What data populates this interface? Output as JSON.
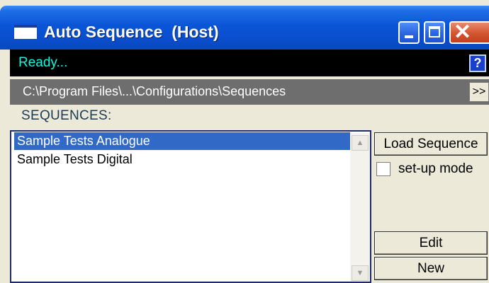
{
  "window": {
    "title": "Auto Sequence  (Host)",
    "controls": {
      "minimize": "minimize",
      "maximize": "maximize",
      "close": "✕"
    }
  },
  "status": {
    "text": "Ready...",
    "help_label": "?"
  },
  "path": {
    "text": "C:\\Program Files\\...\\Configurations\\Sequences",
    "expand_label": ">>"
  },
  "sequences": {
    "heading": "SEQUENCES:",
    "items": [
      {
        "label": "Sample Tests Analogue",
        "selected": true
      },
      {
        "label": "Sample Tests Digital",
        "selected": false
      }
    ]
  },
  "actions": {
    "load_label": "Load Sequence",
    "setup_mode_label": "set-up mode",
    "setup_mode_checked": false,
    "edit_label": "Edit",
    "new_label": "New"
  },
  "colors": {
    "titlebar": "#0a55d6",
    "status_bg": "#000000",
    "status_text": "#00ffe0",
    "path_bg": "#6e6e6e",
    "selection": "#3169c6",
    "close_button": "#d3552f"
  }
}
